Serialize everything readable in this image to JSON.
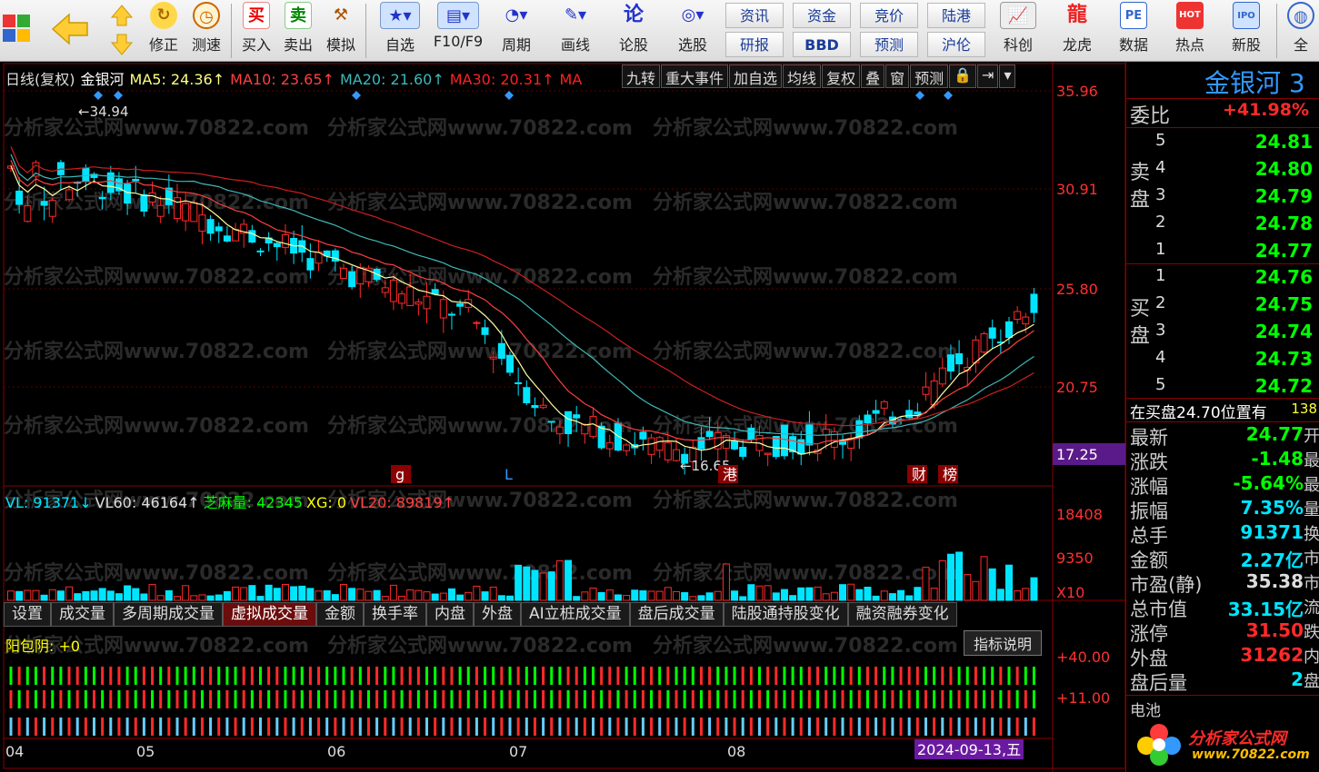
{
  "toolbar": {
    "items": [
      {
        "label": "修正",
        "icon": "refresh-icon"
      },
      {
        "label": "测速",
        "icon": "speed-icon"
      },
      {
        "label": "买入",
        "icon": "buy-icon"
      },
      {
        "label": "卖出",
        "icon": "sell-icon"
      },
      {
        "label": "模拟",
        "icon": "gavel-icon"
      },
      {
        "label": "自选",
        "icon": "star-icon"
      },
      {
        "label": "F10/F9",
        "icon": "f10-icon"
      },
      {
        "label": "周期",
        "icon": "clock-icon"
      },
      {
        "label": "画线",
        "icon": "pencil-icon"
      },
      {
        "label": "论股",
        "icon": "discuss-icon"
      },
      {
        "label": "选股",
        "icon": "select-stock-icon"
      }
    ],
    "pairs": [
      [
        "资讯",
        "研报"
      ],
      [
        "资金",
        "BBD"
      ],
      [
        "竞价",
        "预测"
      ],
      [
        "陆港",
        "沪伦"
      ]
    ],
    "right_items": [
      {
        "label": "科创",
        "icon": "kechuang-icon"
      },
      {
        "label": "龙虎",
        "icon": "dragon-tiger-icon"
      },
      {
        "label": "数据",
        "icon": "pe-data-icon",
        "icon_text": "PE"
      },
      {
        "label": "热点",
        "icon": "hot-icon",
        "icon_text": "HOT"
      },
      {
        "label": "新股",
        "icon": "ipo-icon",
        "icon_text": "IPO"
      },
      {
        "label": "全",
        "icon": "globe-icon"
      }
    ]
  },
  "chart": {
    "period": "日线(复权)",
    "name": "金银河",
    "ma5": "MA5: 24.36↑",
    "ma10": "MA10: 23.65↑",
    "ma20": "MA20: 21.60↑",
    "ma30": "MA30: 20.31↑",
    "ma_label": "MA",
    "buttons": [
      "九转",
      "重大事件",
      "加自选",
      "均线",
      "复权",
      "叠",
      "窗",
      "预测",
      "🔒",
      "⇥",
      "▾"
    ],
    "price_ticks": [
      "35.96",
      "30.91",
      "25.80",
      "20.75",
      "17.25"
    ],
    "high_mark": "←34.94",
    "low_mark": "←16.65",
    "markers": [
      "g",
      "L",
      "港",
      "财",
      "榜"
    ],
    "watermark": "分析家公式网www.70822.com",
    "x_labels": [
      "04",
      "05",
      "06",
      "07",
      "08"
    ],
    "date_label": "2024-09-13,五",
    "colors": {
      "up": "#ff2a2a",
      "down": "#00e5ff",
      "ma5": "#ffffa0",
      "ma10": "#ff4040",
      "ma20": "#3fb8b8",
      "ma30": "#cc1f1f"
    }
  },
  "volume": {
    "vl": "VL: 91371↓",
    "vl60": "VL60: 46164↑",
    "zhima": "芝麻量: 42345",
    "xg": "XG: 0",
    "vl20": "VL20: 89819↑",
    "ticks": [
      "18408",
      "9350",
      "X10"
    ]
  },
  "tabs": [
    "设置",
    "成交量",
    "多周期成交量",
    "虚拟成交量",
    "金额",
    "换手率",
    "内盘",
    "外盘",
    "AI立桩成交量",
    "盘后成交量",
    "陆股通持股变化",
    "融资融券变化"
  ],
  "active_tab": "虚拟成交量",
  "indicator": {
    "label": "阳包阴: +0",
    "button": "指标说明",
    "ticks": [
      "+40.00",
      "+11.00"
    ]
  },
  "quote": {
    "name": "金银河 3",
    "weibi_label": "委比",
    "weibi_value": "+41.98%",
    "sell_label": "卖盘",
    "buy_label": "买盘",
    "sell": [
      {
        "level": "5",
        "price": "24.81"
      },
      {
        "level": "4",
        "price": "24.80"
      },
      {
        "level": "3",
        "price": "24.79"
      },
      {
        "level": "2",
        "price": "24.78"
      },
      {
        "level": "1",
        "price": "24.77"
      }
    ],
    "buy": [
      {
        "level": "1",
        "price": "24.76"
      },
      {
        "level": "2",
        "price": "24.75"
      },
      {
        "level": "3",
        "price": "24.74"
      },
      {
        "level": "4",
        "price": "24.73"
      },
      {
        "level": "5",
        "price": "24.72"
      }
    ],
    "note": "在买盘24.70位置有",
    "note_num": "138",
    "stats": [
      {
        "label": "最新",
        "value": "24.77",
        "color": "#00ff00",
        "suffix": "开"
      },
      {
        "label": "涨跌",
        "value": "-1.48",
        "color": "#00ff00",
        "suffix": "最"
      },
      {
        "label": "涨幅",
        "value": "-5.64%",
        "color": "#00ff00",
        "suffix": "最"
      },
      {
        "label": "振幅",
        "value": "7.35%",
        "color": "#00e5ff",
        "suffix": "量"
      },
      {
        "label": "总手",
        "value": "91371",
        "color": "#00e5ff",
        "suffix": "换"
      },
      {
        "label": "金额",
        "value": "2.27亿",
        "color": "#00e5ff",
        "suffix": "市"
      },
      {
        "label": "市盈(静)",
        "value": "35.38",
        "color": "#dddddd",
        "suffix": "市"
      },
      {
        "label": "总市值",
        "value": "33.15亿",
        "color": "#00e5ff",
        "suffix": "流"
      },
      {
        "label": "涨停",
        "value": "31.50",
        "color": "#ff2a2a",
        "suffix": "跌"
      },
      {
        "label": "外盘",
        "value": "31262",
        "color": "#ff2a2a",
        "suffix": "内"
      },
      {
        "label": "盘后量",
        "value": "2",
        "color": "#00e5ff",
        "suffix": "盘"
      }
    ],
    "battery_label": "电池"
  },
  "logo": {
    "text": "分析家公式网",
    "url": "www.70822.com"
  }
}
